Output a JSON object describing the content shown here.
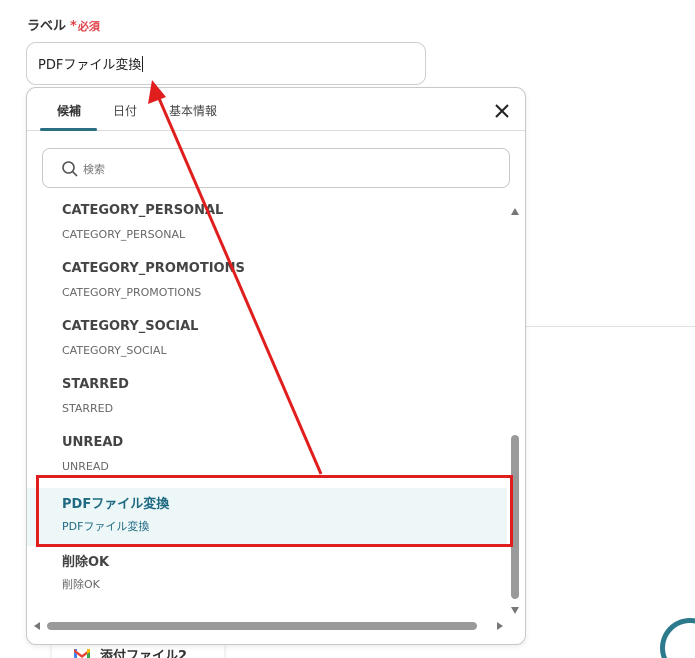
{
  "field": {
    "label": "ラベル",
    "required_star": "*",
    "required_text": "必須",
    "value": "PDFファイル変換"
  },
  "dropdown": {
    "tabs": [
      {
        "label": "候補",
        "active": true
      },
      {
        "label": "日付",
        "active": false
      },
      {
        "label": "基本情報",
        "active": false
      }
    ],
    "search_placeholder": "検索",
    "items": [
      {
        "title": "CATEGORY_PERSONAL",
        "sub": "CATEGORY_PERSONAL"
      },
      {
        "title": "CATEGORY_PROMOTIONS",
        "sub": "CATEGORY_PROMOTIONS"
      },
      {
        "title": "CATEGORY_SOCIAL",
        "sub": "CATEGORY_SOCIAL"
      },
      {
        "title": "STARRED",
        "sub": "STARRED"
      },
      {
        "title": "UNREAD",
        "sub": "UNREAD"
      },
      {
        "title": "PDFファイル変換",
        "sub": "PDFファイル変換",
        "selected": true
      },
      {
        "title": "削除OK",
        "sub": "削除OK"
      }
    ]
  },
  "background": {
    "card_text": "添付ファイル2"
  },
  "colors": {
    "accent": "#2a6f84",
    "required": "#e0434b",
    "annotation": "#e01e1e",
    "selected_bg": "#eef7f7"
  },
  "icons": [
    "search-icon",
    "close-icon",
    "gmail-icon",
    "scroll-up-icon",
    "scroll-down-icon",
    "scroll-left-icon",
    "scroll-right-icon"
  ]
}
